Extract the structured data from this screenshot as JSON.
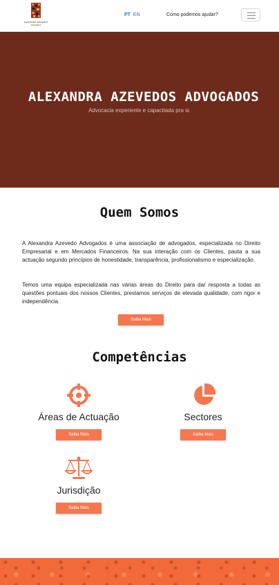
{
  "header": {
    "logo_text": "ALEXANDRA AZEVEDOS advogados",
    "lang_pt": "PT",
    "lang_en": "EN",
    "help_link": "Como podemos ajudar?",
    "menu_icon": "hamburger-menu-icon"
  },
  "hero": {
    "title": "ALEXANDRA AZEVEDOS ADVOGADOS",
    "subtitle": "Advocacia experiente e capacitada pra si."
  },
  "about": {
    "title": "Quem Somos",
    "paragraph1": "A Alexandra Azevedo Advogados é uma associação de advogados, especializada no Direito Empresarial e em Mercados Financeiros. Na sua interação com os Clientes, pauta a sua actuação segundo princípios de honestidade, transparência, profissionalismo e especialização.",
    "paragraph2": "Temos uma equipa especializada nas várias áreas do Direito para dar resposta a todas as questões pontuais dos nossos Clientes, prestamos serviços de elevada qualidade, com rigor e independência.",
    "button": "Saiba Mais"
  },
  "competencias": {
    "title": "Competências",
    "items": [
      {
        "label": "Áreas de Actuação",
        "button": "Saiba Mais",
        "icon": "crosshair-icon"
      },
      {
        "label": "Sectores",
        "button": "Saiba Mais",
        "icon": "pie-chart-icon"
      },
      {
        "label": "Jurisdição",
        "button": "Saiba Mais",
        "icon": "scales-icon"
      }
    ]
  },
  "colors": {
    "hero_bg": "#6e2a1b",
    "accent": "#f4774f",
    "link": "#1a73c8"
  }
}
